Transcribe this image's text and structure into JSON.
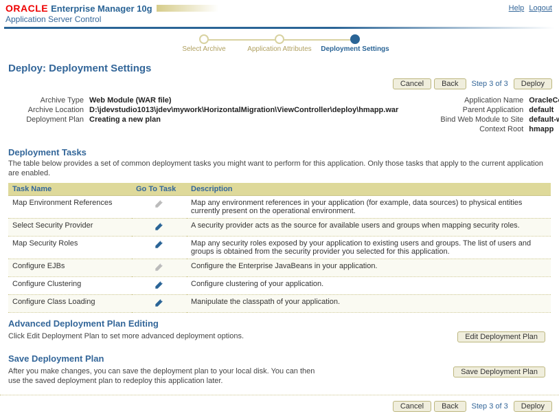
{
  "header": {
    "brand_oracle": "ORACLE",
    "brand_em": "Enterprise Manager 10g",
    "asc": "Application Server Control",
    "links": {
      "help": "Help",
      "logout": "Logout"
    }
  },
  "wizard": {
    "step1": "Select Archive",
    "step2": "Application Attributes",
    "step3": "Deployment Settings"
  },
  "page": {
    "title": "Deploy: Deployment Settings",
    "step_indicator": "Step 3 of 3",
    "cancel": "Cancel",
    "back": "Back",
    "deploy": "Deploy"
  },
  "info_left_labels": {
    "archive_type": "Archive Type",
    "archive_location": "Archive Location",
    "deployment_plan": "Deployment Plan"
  },
  "info_left_values": {
    "archive_type": "Web Module (WAR file)",
    "archive_location": "D:\\jdevstudio1013\\jdev\\mywork\\HorizontalMigration\\ViewController\\deploy\\hmapp.war",
    "deployment_plan": "Creating a new plan"
  },
  "info_right_labels": {
    "app_name": "Application Name",
    "parent_app": "Parent Application",
    "bind_site": "Bind Web Module to Site",
    "context_root": "Context Root"
  },
  "info_right_values": {
    "app_name": "OracleConfigurationmanager",
    "parent_app": "default",
    "bind_site": "default-web-site",
    "context_root": "hmapp"
  },
  "tasks": {
    "title": "Deployment Tasks",
    "desc": "The table below provides a set of common deployment tasks you might want to perform for this application. Only those tasks that apply to the current application are enabled.",
    "col_name": "Task Name",
    "col_goto": "Go To Task",
    "col_desc": "Description",
    "rows": [
      {
        "name": "Map Environment References",
        "enabled": false,
        "desc": "Map any environment references in your application (for example, data sources) to physical entities currently present on the operational environment."
      },
      {
        "name": "Select Security Provider",
        "enabled": true,
        "desc": "A security provider acts as the source for available users and groups when mapping security roles."
      },
      {
        "name": "Map Security Roles",
        "enabled": true,
        "desc": "Map any security roles exposed by your application to existing users and groups. The list of users and groups is obtained from the security provider you selected for this application."
      },
      {
        "name": "Configure EJBs",
        "enabled": false,
        "desc": "Configure the Enterprise JavaBeans in your application."
      },
      {
        "name": "Configure Clustering",
        "enabled": true,
        "desc": "Configure clustering of your application."
      },
      {
        "name": "Configure Class Loading",
        "enabled": true,
        "desc": "Manipulate the classpath of your application."
      }
    ]
  },
  "advanced": {
    "title": "Advanced Deployment Plan Editing",
    "desc": "Click Edit Deployment Plan to set more advanced deployment options.",
    "btn": "Edit Deployment Plan"
  },
  "save": {
    "title": "Save Deployment Plan",
    "desc": "After you make changes, you can save the deployment plan to your local disk. You can then use the saved deployment plan to redeploy this application later.",
    "btn": "Save Deployment Plan"
  }
}
